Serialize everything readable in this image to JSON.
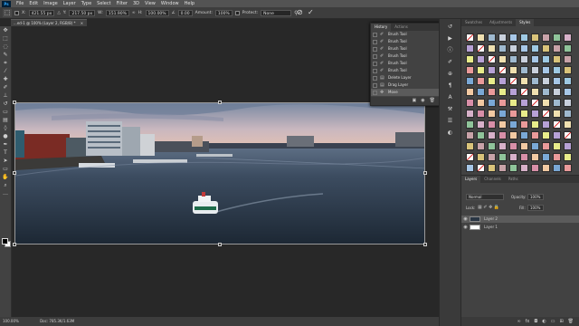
{
  "menubar": {
    "logo": "Ps",
    "items": [
      "File",
      "Edit",
      "Image",
      "Layer",
      "Type",
      "Select",
      "Filter",
      "3D",
      "View",
      "Window",
      "Help"
    ]
  },
  "options": {
    "x_label": "X:",
    "x_value": "421.55 px",
    "y_label": "Y:",
    "y_value": "217.50 px",
    "w_label": "W:",
    "w_value": "151.90%",
    "h_label": "H:",
    "h_value": "100.00%",
    "angle_value": "0.00",
    "interp_label": "Interpolation",
    "amount_label": "Amount:",
    "amount_value": "100%",
    "protect_label": "Protect:",
    "protect_value": "None"
  },
  "document_tab": "...ed-1 @ 100% (Layer 2, RGB/8) *",
  "history": {
    "tabs": [
      "History",
      "Actions"
    ],
    "items": [
      "Brush Tool",
      "Brush Tool",
      "Brush Tool",
      "Brush Tool",
      "Brush Tool",
      "Brush Tool",
      "Delete Layer",
      "Drag Layer",
      "Move"
    ]
  },
  "right_tabs": [
    "Swatches",
    "Adjustments",
    "Styles"
  ],
  "layers": {
    "tabs": [
      "Layers",
      "Channels",
      "Paths"
    ],
    "blend_mode": "Normal",
    "opacity_label": "Opacity:",
    "opacity_value": "100%",
    "lock_label": "Lock:",
    "fill_label": "Fill:",
    "fill_value": "100%",
    "rows": [
      "Layer 2",
      "Layer 1"
    ]
  },
  "status": {
    "zoom": "100.00%",
    "doc": "Doc: 785.3K/1.63M"
  },
  "colors": {
    "accent": "#31a8ff",
    "panel": "#424242",
    "background": "#282828"
  }
}
